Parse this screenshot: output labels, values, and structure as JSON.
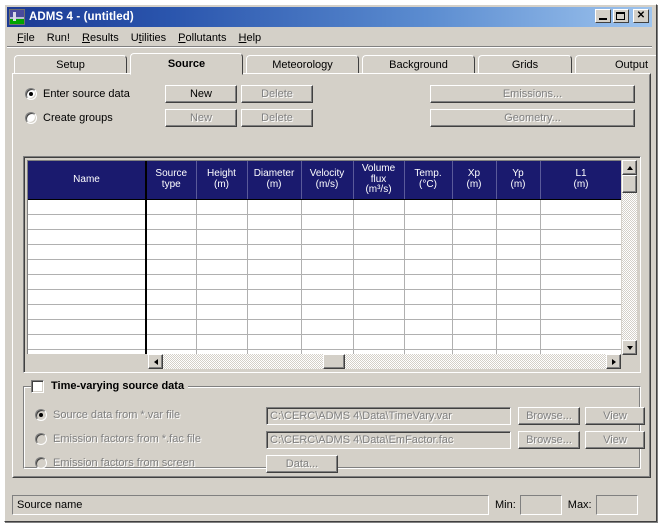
{
  "window": {
    "title": "ADMS 4 - (untitled)",
    "icon": "adms-app-icon",
    "controls": {
      "minimize": "minimize-icon",
      "maximize": "maximize-icon",
      "close": "close-icon"
    }
  },
  "menu": {
    "items": [
      {
        "label": "File",
        "accel": "F"
      },
      {
        "label": "Run!",
        "accel": ""
      },
      {
        "label": "Results",
        "accel": "R"
      },
      {
        "label": "Utilities",
        "accel": "t"
      },
      {
        "label": "Pollutants",
        "accel": "P"
      },
      {
        "label": "Help",
        "accel": "H"
      }
    ]
  },
  "tabs": [
    {
      "label": "Setup",
      "active": false
    },
    {
      "label": "Source",
      "active": true
    },
    {
      "label": "Meteorology",
      "active": false
    },
    {
      "label": "Background",
      "active": false
    },
    {
      "label": "Grids",
      "active": false
    },
    {
      "label": "Output",
      "active": false
    }
  ],
  "source_mode": {
    "options": [
      {
        "label": "Enter source data",
        "checked": true,
        "enabled": true
      },
      {
        "label": "Create groups",
        "checked": false,
        "enabled": true
      }
    ],
    "buttons": [
      {
        "label": "New",
        "enabled": true
      },
      {
        "label": "Delete",
        "enabled": false
      },
      {
        "label": "New",
        "enabled": false
      },
      {
        "label": "Delete",
        "enabled": false
      }
    ],
    "side_buttons": [
      {
        "label": "Emissions...",
        "enabled": false
      },
      {
        "label": "Geometry...",
        "enabled": false
      }
    ]
  },
  "table": {
    "columns": [
      {
        "header": "Name",
        "unit": ""
      },
      {
        "header": "Source",
        "header2": "type",
        "unit": ""
      },
      {
        "header": "Height",
        "unit": "(m)"
      },
      {
        "header": "Diameter",
        "unit": "(m)"
      },
      {
        "header": "Velocity",
        "unit": "(m/s)"
      },
      {
        "header": "Volume",
        "header2": "flux",
        "unit": "(m³/s)"
      },
      {
        "header": "Temp.",
        "unit": "(°C)"
      },
      {
        "header": "Xp",
        "unit": "(m)"
      },
      {
        "header": "Yp",
        "unit": "(m)"
      },
      {
        "header": "L1",
        "unit": "(m)"
      }
    ],
    "rows": [],
    "empty_row_count": 11
  },
  "time_varying": {
    "group_title": "Time-varying source data",
    "group_checked": false,
    "rows": [
      {
        "radio_label": "Source data from *.var file",
        "checked": true,
        "enabled": false,
        "value": "C:\\CERC\\ADMS 4\\Data\\TimeVary.var",
        "browse_label": "Browse...",
        "view_label": "View"
      },
      {
        "radio_label": "Emission factors from *.fac file",
        "checked": false,
        "enabled": false,
        "value": "C:\\CERC\\ADMS 4\\Data\\EmFactor.fac",
        "browse_label": "Browse...",
        "view_label": "View"
      }
    ],
    "screen_row": {
      "radio_label": "Emission factors from screen",
      "checked": false,
      "enabled": false,
      "data_label": "Data..."
    }
  },
  "statusbar": {
    "message": "Source name",
    "min_label": "Min:",
    "min_value": "",
    "max_label": "Max:",
    "max_value": ""
  },
  "colors": {
    "face": "#d4d0c8",
    "title_left": "#1c3a94",
    "title_right": "#9ec4ee",
    "grid_header": "#1a1a6e",
    "disabled_text": "#808080"
  }
}
